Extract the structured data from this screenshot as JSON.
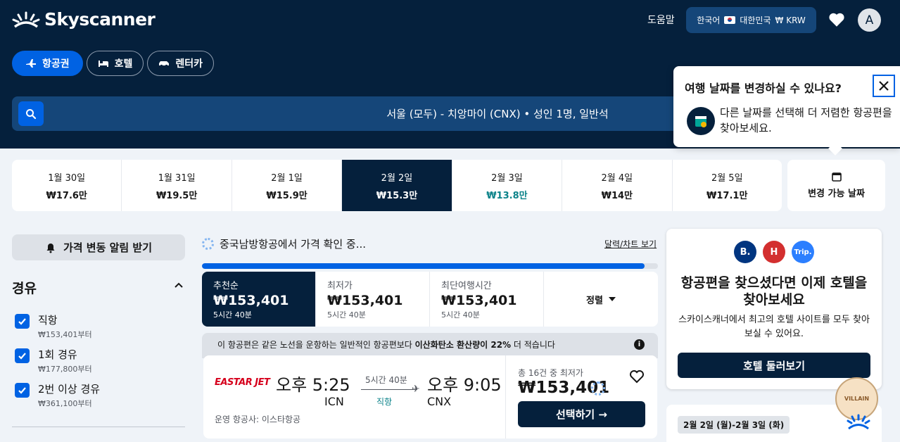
{
  "header": {
    "brand": "Skyscanner",
    "help": "도움말",
    "locale": {
      "language": "한국어",
      "country": "대한민국",
      "currency": "₩ KRW"
    },
    "avatar_initial": "A"
  },
  "tabs": [
    {
      "label": "항공권",
      "icon": "plane-icon",
      "active": true
    },
    {
      "label": "호텔",
      "icon": "bed-icon",
      "active": false
    },
    {
      "label": "렌터카",
      "icon": "car-icon",
      "active": false
    }
  ],
  "search": {
    "summary": "서울 (모두) - 치앙마이 (CNX)  •  성인 1명, 일반석"
  },
  "dates": [
    {
      "date": "1월 30일",
      "price": "₩17.6만"
    },
    {
      "date": "1월 31일",
      "price": "₩19.5만"
    },
    {
      "date": "2월 1일",
      "price": "₩15.9만"
    },
    {
      "date": "2월 2일",
      "price": "₩15.3만",
      "selected": true
    },
    {
      "date": "2월 3일",
      "price": "₩13.8만",
      "cheapest": true
    },
    {
      "date": "2월 4일",
      "price": "₩14만"
    },
    {
      "date": "2월 5일",
      "price": "₩17.1만"
    }
  ],
  "flexible_dates": "변경 가능 날짜",
  "filters": {
    "price_alert": "가격 변동 알림 받기",
    "stops_title": "경유",
    "stops": [
      {
        "label": "직항",
        "sub": "₩153,401부터",
        "checked": true
      },
      {
        "label": "1회 경유",
        "sub": "₩177,800부터",
        "checked": true
      },
      {
        "label": "2번 이상 경유",
        "sub": "₩361,100부터",
        "checked": true
      }
    ]
  },
  "results": {
    "loading_text": "중국남방항공에서 가격 확인 중...",
    "calendar_link": "달력/차트 보기",
    "progress": 0.97,
    "sort_tabs": [
      {
        "title": "추천순",
        "price": "₩153,401",
        "duration": "5시간 40분",
        "active": true
      },
      {
        "title": "최저가",
        "price": "₩153,401",
        "duration": "5시간 40분"
      },
      {
        "title": "최단여행시간",
        "price": "₩153,401",
        "duration": "5시간 40분"
      }
    ],
    "sort_label": "정렬",
    "eco_prefix": "이 항공편은 같은 노선을 운항하는 일반적인 항공편보다 ",
    "eco_bold": "이산화탄소 환산량이 22%",
    "eco_suffix": " 더 적습니다",
    "flight": {
      "airline_logo": "EASTAR JET",
      "depart_time": "오후 5:25",
      "depart_code": "ICN",
      "arrive_time": "오후 9:05",
      "arrive_code": "CNX",
      "duration": "5시간 40분",
      "stops": "직항",
      "operated_by": "운영 항공사: 이스타항공",
      "deals": "총 16건 중 최저가",
      "price": "₩153,401",
      "select_label": "선택하기 →"
    }
  },
  "hotel_promo": {
    "brands": [
      {
        "label": "B.",
        "color": "#003580"
      },
      {
        "label": "H",
        "color": "#d32f2f"
      },
      {
        "label": "Trip.",
        "color": "#2c7fff"
      }
    ],
    "title": "항공편을 찾으셨다면 이제 호텔을 찾아보세요",
    "desc": "스카이스캐너에서 최고의 호텔 사이트를 모두 찾아보실 수 있어요.",
    "button": "호텔 둘러보기"
  },
  "tip": {
    "date_range": "2월 2일 (월)-2월 3일 (화)"
  },
  "villain_badge": "VILLAIN",
  "popover": {
    "title": "여행 날짜를 변경하실 수 있나요?",
    "line1": "다른 날짜를 선택해 더 저렴한 항공편을",
    "line2": "찾아보세요."
  }
}
